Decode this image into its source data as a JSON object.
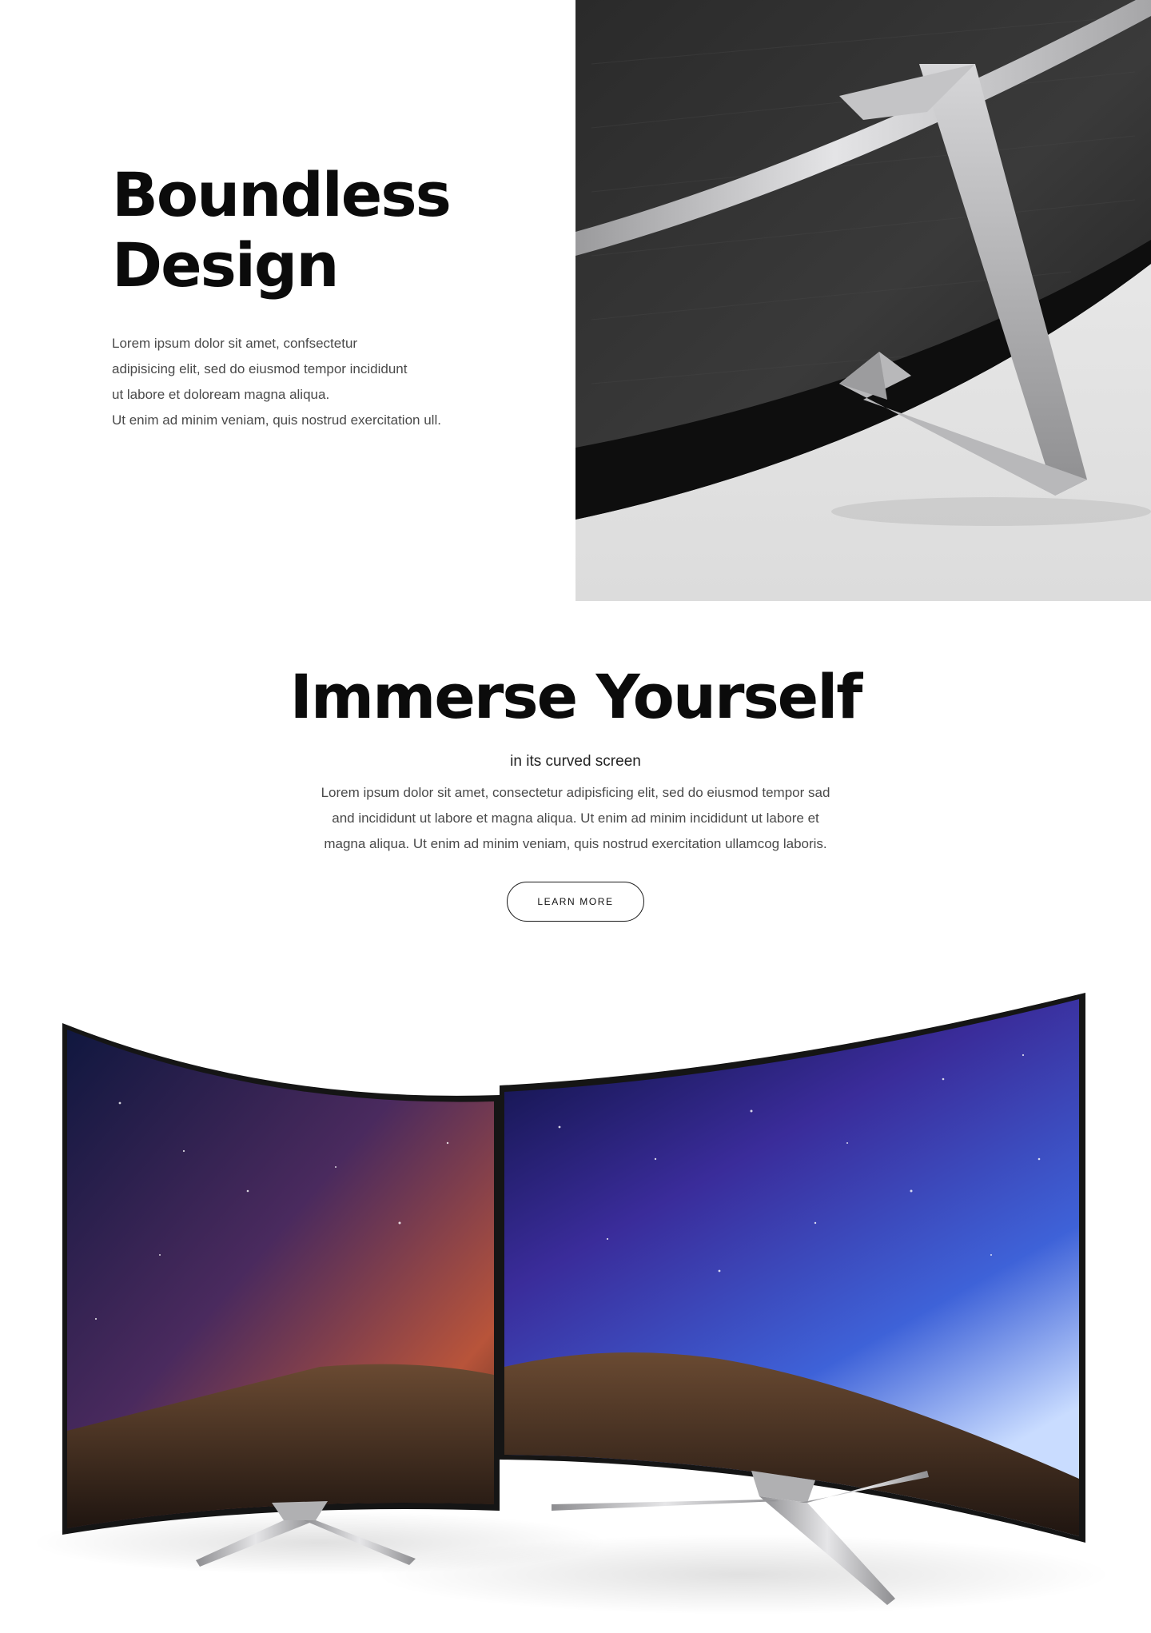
{
  "design": {
    "title_line1": "Boundless",
    "title_line2": "Design",
    "body_lines": [
      "Lorem ipsum dolor sit amet, confsectetur",
      "adipisicing elit, sed do eiusmod tempor incididunt",
      "ut labore et doloream magna aliqua.",
      "Ut enim ad minim veniam, quis nostrud exercitation ull."
    ]
  },
  "immerse": {
    "title": "Immerse Yourself",
    "subtitle": "in its curved screen",
    "body_lines": [
      "Lorem ipsum dolor sit amet, consectetur adipisficing elit, sed do eiusmod tempor sad",
      "and incididunt ut labore et magna aliqua. Ut enim ad minim incididunt ut labore et",
      "magna aliqua. Ut enim ad minim veniam, quis nostrud exercitation ullamcog laboris."
    ],
    "cta_label": "LEARN MORE"
  },
  "colors": {
    "heading": "#0b0b0b",
    "body_text": "#4a4a4a",
    "tv_frame": "#1c1c1c",
    "stand_silver": "#c9c9cb"
  }
}
